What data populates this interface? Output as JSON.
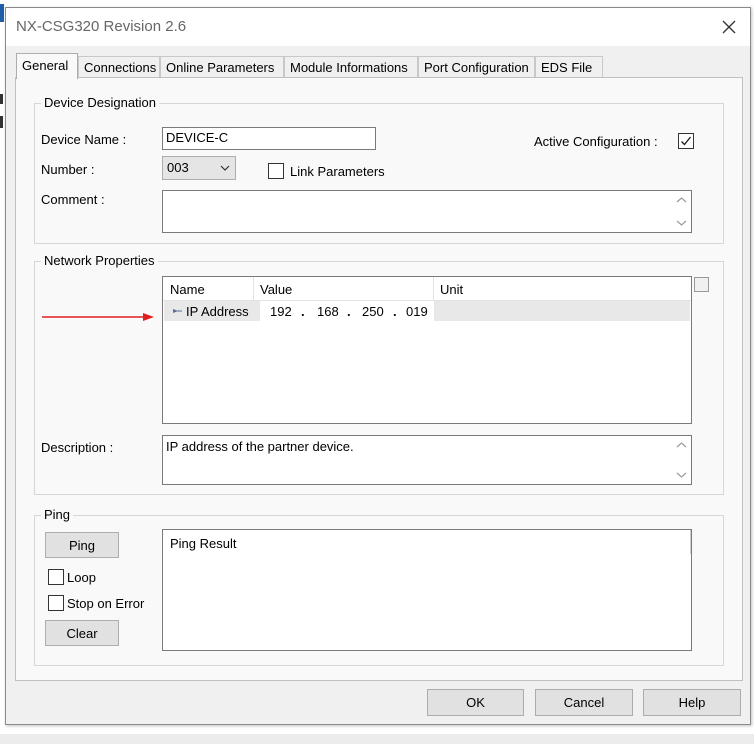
{
  "background": {
    "accent": "#1f5fa8"
  },
  "window": {
    "title": "NX-CSG320 Revision 2.6"
  },
  "tabs": [
    {
      "label": "General",
      "active": true
    },
    {
      "label": "Connections"
    },
    {
      "label": "Online Parameters"
    },
    {
      "label": "Module Informations"
    },
    {
      "label": "Port Configuration"
    },
    {
      "label": "EDS File"
    }
  ],
  "device_designation": {
    "legend": "Device Designation",
    "device_name_label": "Device Name :",
    "device_name_value": "DEVICE-C",
    "active_config_label": "Active Configuration :",
    "active_config_checked": true,
    "number_label": "Number :",
    "number_value": "003",
    "link_params_label": "Link Parameters",
    "link_params_checked": false,
    "comment_label": "Comment :",
    "comment_value": ""
  },
  "network_properties": {
    "legend": "Network Properties",
    "columns": {
      "name": "Name",
      "value": "Value",
      "unit": "Unit"
    },
    "rows": [
      {
        "name": "IP Address",
        "ip": [
          "192",
          "168",
          "250",
          "019"
        ],
        "unit": ""
      }
    ],
    "description_label": "Description :",
    "description_value": "IP address of the partner device."
  },
  "ping": {
    "legend": "Ping",
    "ping_button": "Ping",
    "loop_label": "Loop",
    "loop_checked": false,
    "stop_on_error_label": "Stop on Error",
    "stop_on_error_checked": false,
    "clear_button": "Clear",
    "result_text": "Ping Result"
  },
  "footer": {
    "ok": "OK",
    "cancel": "Cancel",
    "help": "Help"
  },
  "annotation": {
    "arrow_color": "#e02020"
  }
}
